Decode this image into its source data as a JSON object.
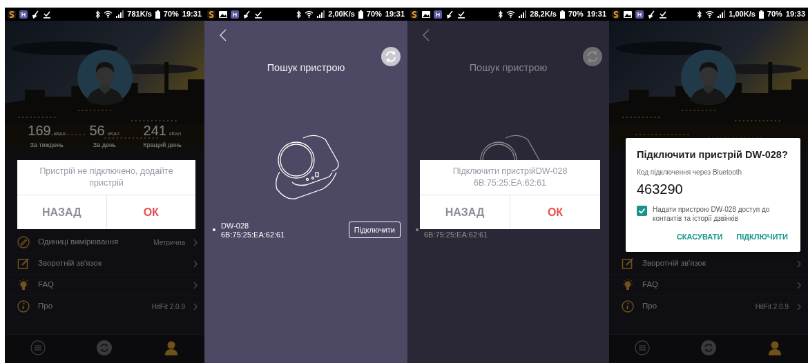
{
  "screens": [
    {
      "kind": "profile",
      "status_bar": {
        "net_speed": "781K/s",
        "battery": "70%",
        "time": "19:31"
      },
      "stats": [
        {
          "value": "169",
          "unit": "кКал",
          "label": "За тиждень"
        },
        {
          "value": "56",
          "unit": "кКал",
          "label": "За день"
        },
        {
          "value": "241",
          "unit": "кКал",
          "label": "Кращий день"
        }
      ],
      "menu": [
        {
          "kind": "units",
          "label": "Одиниці вимірювання",
          "value": "Метрична"
        },
        {
          "kind": "feedback",
          "label": "Зворотній зв'язок"
        },
        {
          "kind": "faq",
          "label": "FAQ"
        },
        {
          "kind": "about",
          "label": "Про",
          "value": "HitFit 2.0.9"
        }
      ],
      "nav": [
        {
          "selected": false
        },
        {
          "selected": false
        },
        {
          "selected": true
        }
      ],
      "dialog": {
        "kind": "alert",
        "lines": [
          "Пристрій не підключено, додайте пристрій"
        ],
        "buttons": [
          {
            "label": "НАЗАД",
            "kind": "cancel"
          },
          {
            "label": "ОК",
            "kind": "confirm"
          }
        ]
      }
    },
    {
      "kind": "search",
      "status_bar": {
        "net_speed": "2,00K/s",
        "battery": "70%",
        "time": "19:31"
      },
      "title": "Пошук пристрою",
      "devices": [
        {
          "name": "DW-028",
          "address": "6B:75:25:EA:62:61",
          "button": "Підключити"
        }
      ]
    },
    {
      "kind": "search",
      "status_bar": {
        "net_speed": "28,2K/s",
        "battery": "70%",
        "time": "19:31"
      },
      "title": "Пошук пристрою",
      "devices": [
        {
          "address": "6B:75:25:EA:62:61"
        }
      ],
      "dialog": {
        "kind": "alert",
        "lines": [
          "Підключити пристрійDW-028",
          "6B:75:25:EA:62:61"
        ],
        "buttons": [
          {
            "label": "НАЗАД",
            "kind": "cancel"
          },
          {
            "label": "ОК",
            "kind": "confirm"
          }
        ]
      }
    },
    {
      "kind": "profile",
      "status_bar": {
        "net_speed": "1,00K/s",
        "battery": "70%",
        "time": "19:33"
      },
      "menu": [
        {
          "kind": "feedback",
          "label": "Зворотній зв'язок"
        },
        {
          "kind": "faq",
          "label": "FAQ"
        },
        {
          "kind": "about",
          "label": "Про",
          "value": "HitFit 2.0.9"
        }
      ],
      "nav": [
        {
          "selected": false
        },
        {
          "selected": false
        },
        {
          "selected": true
        }
      ],
      "dialog": {
        "kind": "pair",
        "title": "Підключити пристрій DW-028?",
        "subtitle": "Код підключення через Bluetooth",
        "code": "463290",
        "checkbox": {
          "checked": true,
          "label": "Надати пристрою DW-028 доступ до контактів та історії дзвінків"
        },
        "buttons": [
          {
            "label": "СКАСУВАТИ",
            "kind": "cancel"
          },
          {
            "label": "ПІДКЛЮЧИТИ",
            "kind": "confirm"
          }
        ]
      }
    }
  ]
}
